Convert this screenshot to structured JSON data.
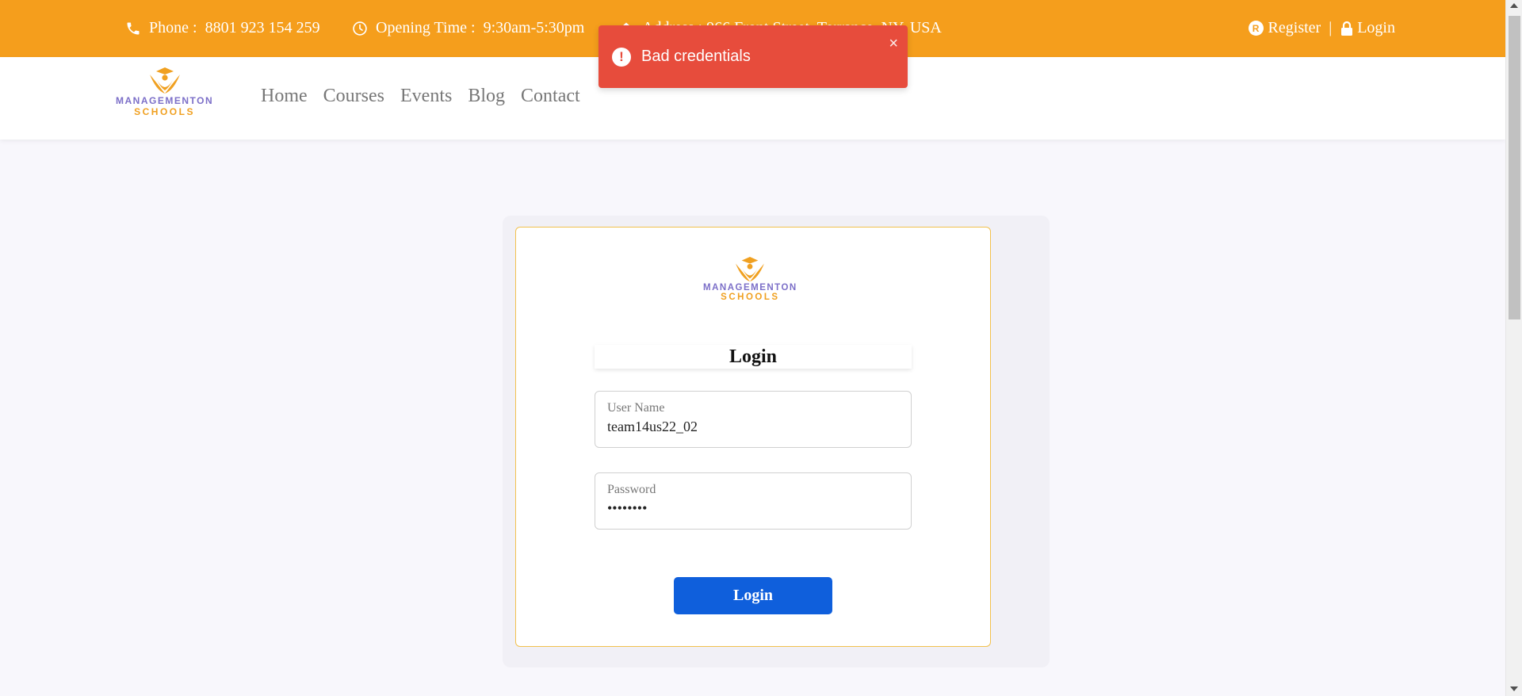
{
  "topbar": {
    "phone_label": "Phone :",
    "phone_value": "8801 923 154 259",
    "hours_label": "Opening Time :",
    "hours_value": "9:30am-5:30pm",
    "address_text": "Address : 966 Front Street, Torrance, NY, USA",
    "register_label": "Register",
    "separator": "|",
    "login_label": "Login"
  },
  "brand": {
    "line1": "MANAGEMENTON",
    "line2": "SCHOOLS"
  },
  "nav": {
    "items": [
      "Home",
      "Courses",
      "Events",
      "Blog",
      "Contact"
    ]
  },
  "login_form": {
    "title": "Login",
    "username_label": "User Name",
    "username_value": "team14us22_02",
    "password_label": "Password",
    "password_value": "••••••••",
    "submit_label": "Login"
  },
  "toast": {
    "message": "Bad credentials",
    "close": "×"
  },
  "colors": {
    "topbar": "#f59e1c",
    "toast": "#e74c3c",
    "button": "#0f5fdc",
    "brand_purple": "#7c6fc8",
    "brand_orange": "#f0a020"
  }
}
